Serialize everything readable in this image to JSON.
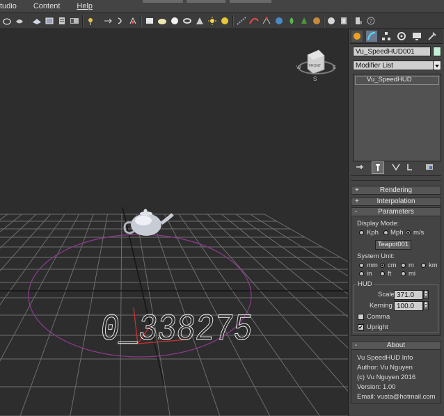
{
  "menu": {
    "items": [
      "tudio",
      "Content",
      "Help"
    ]
  },
  "toolbar": {
    "icons": [
      "teapot-icon",
      "select-icon",
      "render-icon",
      "layer-icon",
      "list-icon",
      "link-icon",
      "bind-icon",
      "move-icon",
      "rotate-icon",
      "scale-icon",
      "box-icon",
      "sphere-icon",
      "cylinder-icon",
      "torus-icon",
      "cone-icon",
      "light-icon",
      "sun-icon",
      "particle-icon",
      "spline-icon",
      "curve-icon",
      "helper-icon",
      "modifier-icon",
      "tree-icon",
      "globe-icon",
      "bone-icon",
      "pin-icon",
      "book-icon",
      "camera-icon",
      "help-icon"
    ]
  },
  "viewport": {
    "viewcube_label": "FRONT",
    "compass": {
      "w": "W",
      "e": "E",
      "s": "S"
    },
    "speed_text": "0_338275",
    "unit_marker": "n"
  },
  "panel": {
    "object_name": "Vu_SpeedHUD001",
    "name_color": "#c8f0d8",
    "modifier_list": "Modifier List",
    "stack_item": "Vu_SpeedHUD",
    "rollouts": {
      "rendering": "Rendering",
      "interpolation": "Interpolation",
      "parameters": "Parameters",
      "about": "About"
    },
    "rollout_signs": {
      "collapsed": "+",
      "expanded": "-"
    },
    "display_mode_label": "Display Mode:",
    "display_modes": [
      "Kph",
      "Mph",
      "m/s"
    ],
    "display_mode_selected": "m/s",
    "target_button": "Teapot001",
    "system_unit_label": "System Unit:",
    "units_row1": [
      "mm",
      "cm",
      "m",
      "km"
    ],
    "units_row2": [
      "in",
      "ft",
      "mi"
    ],
    "unit_selected": "cm",
    "hud_label": "HUD",
    "scale_label": "Scale",
    "scale_value": "371.0",
    "kerning_label": "Kerning",
    "kerning_value": "100.0",
    "comma_label": "Comma",
    "comma_checked": false,
    "upright_label": "Upright",
    "upright_checked": true,
    "check_mark": "✔",
    "spinner": {
      "up": "▲",
      "down": "▼"
    },
    "about_lines": [
      "Vu SpeedHUD Info",
      "Author: Vu Nguyen",
      "(c) Vu Nguyen 2016",
      "Version: 1.00",
      "Email: vusta@hotmail.com"
    ]
  },
  "colors": {
    "accent_purple": "#8a3a8a",
    "grid": "#6e6e6e",
    "teapot": "#c8ccd4"
  }
}
